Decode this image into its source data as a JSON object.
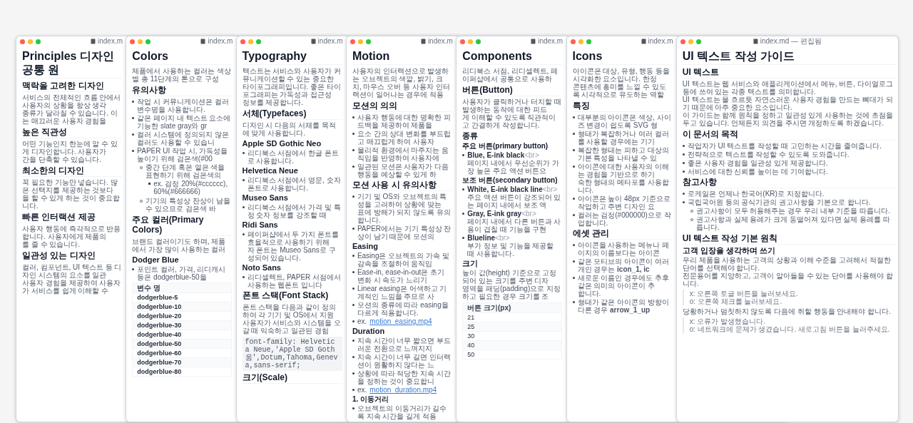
{
  "windows": [
    {
      "title": "index.m",
      "blocks": [
        {
          "kind": "h1",
          "text": "Principles 디자인 공통 원"
        },
        {
          "kind": "h2",
          "text": "맥락을 고려한 디자인"
        },
        {
          "kind": "p",
          "lines": [
            "서비스의 전체적인 흐름 안에서 사용자의 상황을 항상 생각",
            "종류가 달라질 수 있습니다. 이는 매끄러운 사용자 경험을"
          ]
        },
        {
          "kind": "h2",
          "text": "높은 직관성"
        },
        {
          "kind": "p",
          "lines": [
            "어떤 기능인지 한눈에 알 수 있게 디자인합니다. 사용자가",
            "간을 단축할 수 있습니다."
          ]
        },
        {
          "kind": "h2",
          "text": "최소한의 디자인"
        },
        {
          "kind": "p",
          "lines": [
            "꼭 필요한 기능만 넣습니다. 많은 선택지를 제공하는 것보다",
            "을 할 수 있게 하는 것이 중요합니다."
          ]
        },
        {
          "kind": "h2",
          "text": "빠른 인터랙션 제공"
        },
        {
          "kind": "p",
          "lines": [
            "사용자 행동에 즉각적으로 반응합니다. 사용자에게 제품의",
            "를 줄 수 있습니다."
          ]
        },
        {
          "kind": "h2",
          "text": "일관성 있는 디자인"
        },
        {
          "kind": "p",
          "lines": [
            "컬러, 컴포넌트, UI 텍스트 등 디자인 시스템의 요소를 일관",
            "사용자 경험을 제공하여 사용자가 서비스를 쉽게 이해할 수"
          ]
        }
      ]
    },
    {
      "title": "index.m",
      "blocks": [
        {
          "kind": "h1",
          "text": "Colors"
        },
        {
          "kind": "p",
          "lines": [
            "제품에서 사용하는 컬러는 색상 별 총 11단계의 톤으로 구성"
          ]
        },
        {
          "kind": "h2",
          "text": "유의사항"
        },
        {
          "kind": "ul",
          "items": [
            {
              "text": "작업 시 커뮤니케이션은 컬러 변수명을 사용합니다."
            },
            {
              "text": "같은 페이지 내 텍스트 요소에 기능한 slate gray와 gr"
            },
            {
              "text": "컬러 시스템에 정의되지 않은 컬러도 사용할 수 있습니"
            },
            {
              "text": "PAPER UI 작업 시, 가독성을 높이기 위해 검은색(#00",
              "children": [
                {
                  "text": "중간 단계 혹은 옅은 색을 표현하기 위해 검은색의",
                  "children": [
                    {
                      "text": "ex. 검정 20%(#cccccc), 60%(#666666)"
                    }
                  ]
                },
                {
                  "text": "기기의 특성상 잔상이 남을 수 있으므로 검은색 바"
                }
              ]
            }
          ]
        },
        {
          "kind": "h2",
          "text": "주요 컬러(Primary Colors)"
        },
        {
          "kind": "p",
          "lines": [
            "브랜드 컬러이기도 하며, 제품에서 가장 많이 사용하는 컬러"
          ]
        },
        {
          "kind": "h3",
          "text": "Dodger Blue"
        },
        {
          "kind": "ul",
          "items": [
            {
              "text": "포인트 컬러, 가격, 리디캐시 등은 dodgerblue-50을"
            }
          ]
        },
        {
          "kind": "table",
          "header": "변수 명",
          "bold": true,
          "rows": [
            "dodgerblue-5",
            "dodgerblue-10",
            "dodgerblue-20",
            "dodgerblue-30",
            "dodgerblue-40",
            "dodgerblue-50",
            "dodgerblue-60",
            "dodgerblue-70",
            "dodgerblue-80"
          ]
        }
      ]
    },
    {
      "title": "index.m",
      "blocks": [
        {
          "kind": "h1",
          "text": "Typography"
        },
        {
          "kind": "p",
          "lines": [
            "텍스트는 서비스와 사용자가 커뮤니케이션할 수 있는 중요한",
            "타이포그래피입니다. 좋은 타이포그래피는 가독성과 접근성",
            "정보를 제공합니다."
          ]
        },
        {
          "kind": "h2",
          "text": "서체(Typefaces)"
        },
        {
          "kind": "p",
          "lines": [
            "디자인 시 다음의 서체를 목적에 맞게 사용합니다."
          ]
        },
        {
          "kind": "h3",
          "text": "Apple SD Gothic Neo"
        },
        {
          "kind": "ul",
          "items": [
            {
              "text": "리디북스 서점에서 한글 폰트로 사용합니다."
            }
          ]
        },
        {
          "kind": "h3",
          "text": "Helvetica Neue"
        },
        {
          "kind": "ul",
          "items": [
            {
              "text": "리디북스 서점에서 영문, 숫자 폰트로 사용합니다."
            }
          ]
        },
        {
          "kind": "h3",
          "text": "Museo Sans"
        },
        {
          "kind": "ul",
          "items": [
            {
              "text": "리디북스 서점에서 가격 및 특정 숫자 정보를 강조할 때"
            }
          ]
        },
        {
          "kind": "h3",
          "text": "Ridi Sans"
        },
        {
          "kind": "ul",
          "items": [
            {
              "lines": [
                "페이퍼샵에서 두 가지 폰트를 효율적으로 사용하기 위해",
                "자 폰트는 Museo Sans로 구성되어 있습니다."
              ]
            }
          ]
        },
        {
          "kind": "h3",
          "text": "Noto Sans"
        },
        {
          "kind": "ul",
          "items": [
            {
              "text": "리디셀렉트, PAPER 서점에서 사용하는 웹폰트 입니다"
            }
          ]
        },
        {
          "kind": "h2",
          "text": "폰트 스택(Font Stack)"
        },
        {
          "kind": "p",
          "lines": [
            "폰트 스택을 다음과 같이 정의하여 각 기기 및 OS에서 지원",
            "사용자가 서비스와 시스템을 오갈 때 익숙하고 일관된 경험"
          ]
        },
        {
          "kind": "code",
          "lines": [
            "font-family: Helvetica Neue,'Apple SD Goth",
            "움',Dotum,Tahoma,Geneva,sans-serif;"
          ]
        },
        {
          "kind": "h2",
          "text": "크기(Scale)"
        }
      ]
    },
    {
      "title": "index.m",
      "blocks": [
        {
          "kind": "h1",
          "text": "Motion"
        },
        {
          "kind": "p",
          "lines": [
            "사용자의 인터랙션으로 발생하는 오브젝트의 색깔, 밝기, 크",
            "치, 마우스 오버 등 사용자 인터랙션이 일어나는 경우에 적용"
          ]
        },
        {
          "kind": "h2",
          "text": "모션의 의의"
        },
        {
          "kind": "ul",
          "items": [
            {
              "text": "사용자 행동에 대한 명확한 피드백을 제공하여 제품을"
            },
            {
              "text": "요소 간의 상대 변화를 부드럽고 매끄럽게 하여 사용자"
            },
            {
              "text": "물리적 환경에서 마주치는 움직임을 반영하여 사용자에"
            },
            {
              "text": "일관된 모션은 사용자가 다음 행동을 예상할 수 있게 하"
            }
          ]
        },
        {
          "kind": "h2",
          "text": "모션 사용 시 유의사항"
        },
        {
          "kind": "ul",
          "items": [
            {
              "lines": [
                "기기 및 OS와 오브젝트의 특성을 고려하여 상황에 맞는",
                "표에 방해가 되지 않도록 유의합니다."
              ]
            },
            {
              "text": "PAPER에서는 기기 특성상 잔상이 남기 때문에 모션의"
            }
          ]
        },
        {
          "kind": "h3",
          "text": "Easing"
        },
        {
          "kind": "ul",
          "items": [
            {
              "text": "Easing은 오브젝트의 가속 및 감속을 조절하여 움직임"
            },
            {
              "text": "Ease-in, ease-in-out은 초기 변화 시 속도가 느리기"
            },
            {
              "text": "Linear easing은 어색하고 기계적인 느낌을 주므로 사"
            },
            {
              "text": "모션의 종류에 따라 easing을 다르게 적용합니다."
            },
            {
              "text": "ex.",
              "link": "motion_easing.mp4"
            }
          ]
        },
        {
          "kind": "h3",
          "text": "Duration"
        },
        {
          "kind": "ul",
          "items": [
            {
              "text": "지속 시간이 너무 짧으면 부드러운 전환으로 느껴지지"
            },
            {
              "text": "지속 시간이 너무 길면 인터랙션이 원활하지 않다는 느"
            },
            {
              "text": "상황에 따라 적당한 지속 시간을 정하는 것이 중요합니"
            },
            {
              "text": "ex.",
              "link": "motion_duration.mp4"
            }
          ]
        },
        {
          "kind": "h4",
          "text": "1. 이동거리"
        },
        {
          "kind": "ul",
          "items": [
            {
              "text": "오브젝트의 이동거리가 길수록 지속 시간을 길게 적용"
            }
          ]
        }
      ]
    },
    {
      "title": "index.m",
      "blocks": [
        {
          "kind": "h1",
          "text": "Components"
        },
        {
          "kind": "p",
          "lines": [
            "리디북스 서점, 리디셀렉트, 페이퍼샵에서 공통으로 사용하"
          ]
        },
        {
          "kind": "h2",
          "text": "버튼(Button)"
        },
        {
          "kind": "p",
          "lines": [
            "사용자가 클릭하거나 터치할 때 발생하는 동작에 대한 피드",
            "게 이해할 수 있도록 직관적이고 간결하게 작성합니다."
          ]
        },
        {
          "kind": "h3",
          "text": "종류"
        },
        {
          "kind": "h4",
          "text": "주요 버튼(primary button)"
        },
        {
          "kind": "ul",
          "items": [
            {
              "title": "Blue, E-ink black",
              "tag": "<br>",
              "lines": [
                "페이지 내에서 우선순위가 가장 높은 주요 액션 버튼으"
              ]
            }
          ]
        },
        {
          "kind": "h4",
          "text": "보조 버튼(secondary button)"
        },
        {
          "kind": "ul",
          "items": [
            {
              "title": "White, E-ink black line",
              "tag": "<br>",
              "lines": [
                "주요 액션 버튼이 강조되어 있는 페이지 내에서 보조 액"
              ]
            },
            {
              "title": "Gray, E-ink gray",
              "tag": "<br>",
              "lines": [
                "페이지 내에서 다른 버튼과 사용이 겹칠 때 기능을 구현"
              ]
            },
            {
              "title": "Blueline",
              "tag": "<br>",
              "lines": [
                "부가 정보 및 기능을 제공할 때 사용합니다."
              ]
            }
          ]
        },
        {
          "kind": "h3",
          "text": "크기"
        },
        {
          "kind": "p",
          "lines": [
            "높이 값(height) 기준으로 고정되어 있는 크기를 주변 디자",
            "영역을 패딩(padding)으로 지정하고 필요한 경우 크기를 조"
          ]
        },
        {
          "kind": "table",
          "header": "버튼 크기(px)",
          "bold": false,
          "rows": [
            "21",
            "25",
            "30",
            "40",
            "50"
          ]
        }
      ]
    },
    {
      "title": "index.m",
      "blocks": [
        {
          "kind": "h1",
          "text": "Icons"
        },
        {
          "kind": "p",
          "lines": [
            "아이콘은 대상, 유형, 행동 등을 시각화한 요소입니다. 한정",
            "콘텐츠에 흥미를 느낄 수 있도록 시각적으로 유도하는 역할"
          ]
        },
        {
          "kind": "h2",
          "text": "특징"
        },
        {
          "kind": "ul",
          "items": [
            {
              "text": "대부분의 아이콘은 색상, 사이즈 변경이 쉽도록 SVG 형"
            },
            {
              "text": "형태가 복잡하거나 여러 컬러를 사용할 경우에는 기기"
            },
            {
              "text": "복잡한 형태는 피하고 대상의 기본 특성을 나타낼 수 있"
            },
            {
              "lines": [
                "아이콘에 대한 사용자의 이해는 경험을 기반으로 하기",
                "숙한 형태의 메타포를 사용합니다."
              ]
            },
            {
              "text": "아이콘은 높이 48px 기준으로 작업하고 주변 디자인 요"
            },
            {
              "text": "컬러는 검정(#000000)으로 작업합니다."
            }
          ]
        },
        {
          "kind": "h2",
          "text": "에셋 관리"
        },
        {
          "kind": "ul",
          "items": [
            {
              "text": "아이콘을 사용하는 메뉴나 페이지의 이름보다는 아이콘"
            },
            {
              "text": "같은 모티브의 아이콘이 여러 개인 경우는 **icon_1, ic**"
            },
            {
              "lines": [
                "새로운 이름인 경우에도 추후 같은 의미의 아이콘이 추",
                "합니다."
              ]
            },
            {
              "text": "형태가 같은 아이콘의 방향이 다른 경우 **arrow_1_up**"
            }
          ]
        }
      ]
    },
    {
      "title": "index.md — 편집됨",
      "blocks": [
        {
          "kind": "h1",
          "text": "UI 텍스트 작성 가이드"
        },
        {
          "kind": "h2",
          "text": "UI 텍스트"
        },
        {
          "kind": "p",
          "lines": [
            "UI 텍스트는 웹 서비스와 애플리케이션에서 메뉴, 버튼, 다이얼로그 등에 쓰여 있는 각종 텍스트를 의미합니다.",
            "UI 텍스트는 물 흐르듯 자연스러운 사용자 경험을 만드는 뼈대가 되기 때문에 아주 중요한 요소입니다.",
            "이 가이드는 함께 원칙을 정하고 일관성 있게 사용하는 것에 초점을 두고 있습니다. 언제든지 의견을 주시면 개정하도록 하겠습니다."
          ]
        },
        {
          "kind": "h2",
          "text": "이 문서의 목적"
        },
        {
          "kind": "ul",
          "items": [
            {
              "text": "작업자가 UI 텍스트를 작성할 때 고민하는 시간을 줄여줍니다."
            },
            {
              "text": "전략적으로 텍스트를 작성할 수 있도록 도와줍니다."
            },
            {
              "text": "좋은 사용자 경험을 일관성 있게 제공합니다."
            },
            {
              "text": "서비스에 대한 신뢰를 높이는 데 기여합니다."
            }
          ]
        },
        {
          "kind": "h2",
          "text": "참고사항"
        },
        {
          "kind": "ul",
          "items": [
            {
              "text": "로케일은 언제나 한국어(KR)로 지정합니다."
            },
            {
              "text": "국립국어원 등의 공식기관의 권고사항을 기본으로 합니다.",
              "children": [
                {
                  "text": "권고사항이 모두 허용해주는 경우 우리 내부 기준을 따릅니다."
                },
                {
                  "text": "권고사항과 실제 용례가 크게 동떨어져 있다면 실제 용례를 따릅니다."
                }
              ]
            }
          ]
        },
        {
          "kind": "h2",
          "text": "UI 텍스트 작성 기본 원칙"
        },
        {
          "kind": "h3",
          "text": "고객 입장을 생각하며 쓰기"
        },
        {
          "kind": "p",
          "lines": [
            "우리 제품을 사용하는 고객의 상황과 이해 수준을 고려해서 적절한 단어를 선택해야 합니다.",
            "전문용어를 지양하고, 고객이 알아들을 수 있는 단어를 사용해야 합니다."
          ]
        },
        {
          "kind": "quote",
          "lines": [
            "x: 오른쪽 토글 버튼을 눌러보세요.",
            "o: 오른쪽 체크를 눌러보세요."
          ]
        },
        {
          "kind": "p",
          "lines": [
            "당황하거나 멈칫하지 않도록 다음에 취할 행동을 안내해야 합니다."
          ]
        },
        {
          "kind": "quote",
          "lines": [
            "x: 오류가 발생했습니다.",
            "o: 네트워크에 문제가 생겼습니다. 새로고침 버튼을 눌러주세요."
          ]
        }
      ]
    }
  ]
}
